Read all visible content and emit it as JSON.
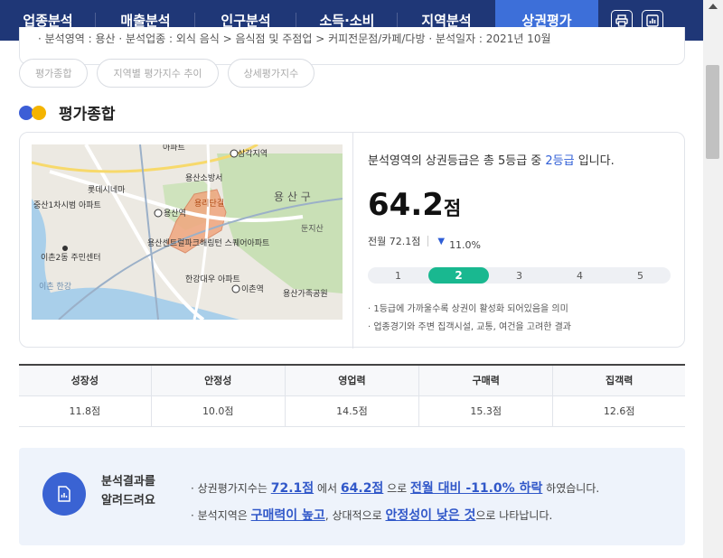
{
  "nav": {
    "tabs": [
      "업종분석",
      "매출분석",
      "인구분석",
      "소득·소비",
      "지역분석",
      "상권평가"
    ],
    "active_tab": "상권평가",
    "icons": [
      "print-icon",
      "chart-report-icon"
    ]
  },
  "filter": {
    "text": "· 분석영역 : 용산      · 분석업종 : 외식 음식 > 음식점 및 주점업 > 커피전문점/카페/다방      · 분석일자 : 2021년 10월"
  },
  "chips": [
    "평가종합",
    "지역별 평가지수 추이",
    "상세평가지수"
  ],
  "section": {
    "title": "평가종합"
  },
  "map": {
    "labels": [
      "아파트",
      "삼각지역",
      "용산소방서",
      "롯데시네마",
      "용리단길",
      "용산역",
      "용 산 구",
      "둔지산",
      "이촌2동 주민센터",
      "용산센트럴파크해링턴 스퀘어아파트",
      "한강대우 아파트",
      "이촌역",
      "용산가족공원",
      "중산1차시범 아파트",
      "이촌 한강"
    ]
  },
  "evaluation": {
    "sentence_prefix": "분석영역의 상권등급은 총 5등급 중 ",
    "grade_text": "2등급",
    "sentence_suffix": " 입니다.",
    "score": "64.2",
    "score_unit": "점",
    "prev_label": "전월 72.1점",
    "change_arrow": "▼",
    "change_pct": "11.0%",
    "grades": [
      "1",
      "2",
      "3",
      "4",
      "5"
    ],
    "current_grade": 2,
    "notes": [
      "· 1등급에 가까울수록 상권이 활성화 되어있음을 의미",
      "· 업종경기와 주변 집객시설, 교통, 여건을 고려한 결과"
    ]
  },
  "indicators": {
    "headers": [
      "성장성",
      "안정성",
      "영업력",
      "구매력",
      "집객력"
    ],
    "values": [
      "11.8점",
      "10.0점",
      "14.5점",
      "15.3점",
      "12.6점"
    ]
  },
  "result": {
    "label_line1": "분석결과를",
    "label_line2": "알려드려요",
    "line1": {
      "pre": "· 상권평가지수는 ",
      "prev": "72.1점",
      "mid1": " 에서 ",
      "curr": "64.2점",
      "mid2": " 으로 ",
      "change": "전월 대비 -11.0% 하락",
      "post": " 하였습니다."
    },
    "line2": {
      "pre": "· 분석지역은 ",
      "strong": "구매력이 높고",
      "mid": ", 상대적으로 ",
      "weak": "안정성이 낮은 것",
      "post": "으로 나타납니다."
    }
  },
  "colors": {
    "nav_bg": "#1f3777",
    "nav_active": "#3d6fd9",
    "accent_blue": "#2f5ed6",
    "grade_active": "#19b890",
    "result_bg": "#eef3fb"
  }
}
